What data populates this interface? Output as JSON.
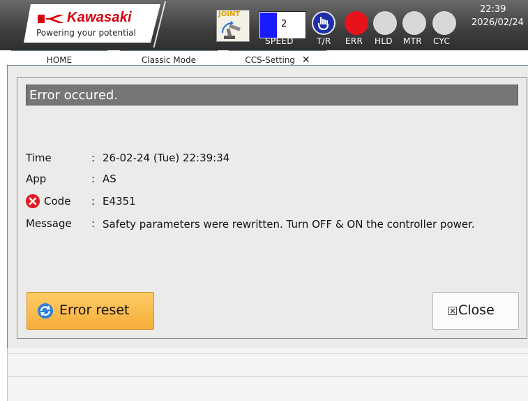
{
  "header": {
    "brand": "Kawasaki",
    "tagline": "Powering your potential",
    "mode_label": "JOINT",
    "speed_value": "2",
    "speed_label": "SPEED",
    "indicators": [
      {
        "label": "T/R",
        "icon": "hand-icon",
        "color": "#1d2fa8"
      },
      {
        "label": "ERR",
        "color": "#e8121a"
      },
      {
        "label": "HLD",
        "color": "#d8d8d8"
      },
      {
        "label": "MTR",
        "color": "#d8d8d8"
      },
      {
        "label": "CYC",
        "color": "#d8d8d8"
      }
    ],
    "time": "22:39",
    "date": "2026/02/24"
  },
  "tabs": [
    {
      "label": "HOME"
    },
    {
      "label": "Classic Mode"
    },
    {
      "label": "CCS-Setting",
      "close": "✕"
    }
  ],
  "dialog": {
    "title": "Error occured.",
    "rows": {
      "time": {
        "label": "Time",
        "colon": ":",
        "value": "26-02-24 (Tue)  22:39:34"
      },
      "app": {
        "label": "App",
        "colon": ":",
        "value": "AS"
      },
      "code": {
        "label": "Code",
        "colon": ":",
        "value": "E4351",
        "icon": "error-x-icon"
      },
      "message": {
        "label": "Message",
        "colon": ":",
        "value": "Safety parameters were rewritten. Turn OFF & ON the controller power."
      }
    },
    "reset_button": {
      "label": "Error reset",
      "icon": "refresh-icon"
    },
    "close_button": {
      "label": "Close",
      "icon": "close-box-icon"
    }
  },
  "colors": {
    "accent_button": "#f6ad3a",
    "error": "#e11b22",
    "title_bar": "#767676",
    "brand_red": "#d7000f"
  }
}
